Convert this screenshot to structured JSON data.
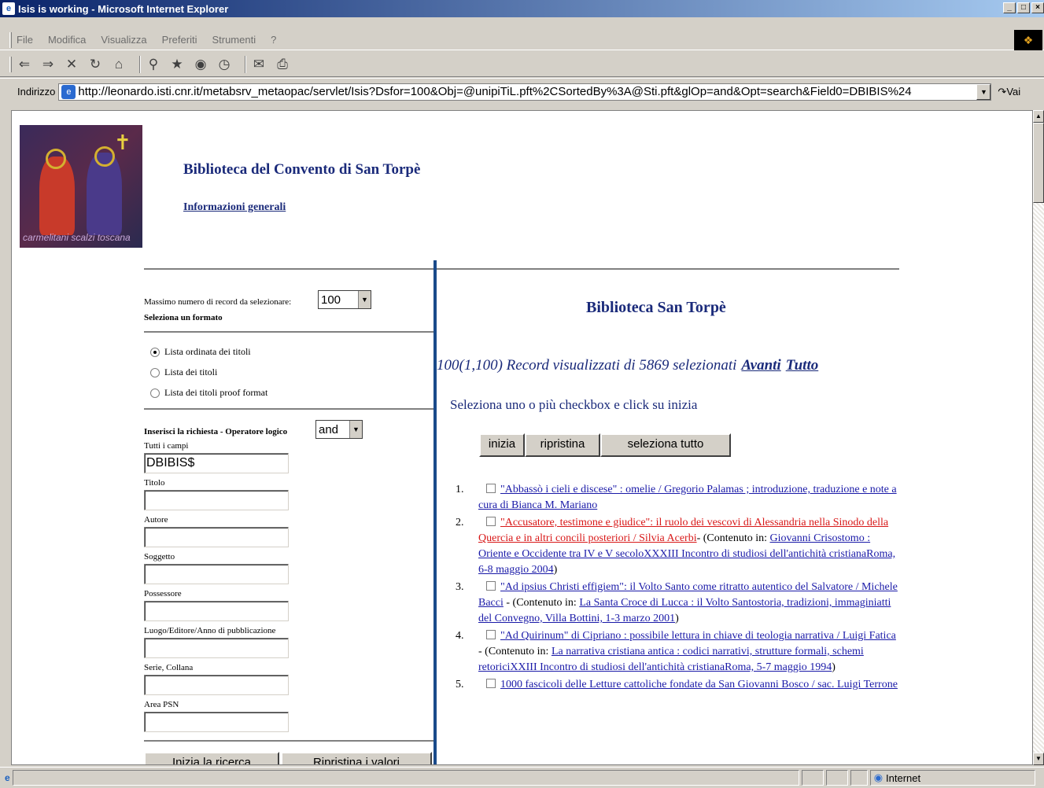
{
  "window": {
    "title": "Isis is working - Microsoft Internet Explorer"
  },
  "menu": [
    "File",
    "Modifica",
    "Visualizza",
    "Preferiti",
    "Strumenti",
    "?"
  ],
  "address": {
    "label": "Indirizzo",
    "url": "http://leonardo.isti.cnr.it/metabsrv_metaopac/servlet/Isis?Dsfor=100&Obj=@unipiTiL.pft%2CSortedBy%3A@Sti.pft&glOp=and&Opt=search&Field0=DBIBIS%24",
    "go": "Vai"
  },
  "header": {
    "title": "Biblioteca del Convento di San Torpè",
    "info_link": "Informazioni generali",
    "logo_caption": "carmelitani scalzi toscana"
  },
  "form": {
    "max_label": "Massimo numero di record da selezionare:",
    "max_value": "100",
    "format_label": "Seleziona un formato",
    "formats": [
      "Lista ordinata dei titoli",
      "Lista dei titoli",
      "Lista dei titoli proof format"
    ],
    "query_label": "Inserisci la richiesta - Operatore logico",
    "operator": "and",
    "fields": [
      {
        "label": "Tutti i campi",
        "value": "DBIBIS$"
      },
      {
        "label": "Titolo",
        "value": ""
      },
      {
        "label": "Autore",
        "value": ""
      },
      {
        "label": "Soggetto",
        "value": ""
      },
      {
        "label": "Possessore",
        "value": ""
      },
      {
        "label": "Luogo/Editore/Anno di pubblicazione",
        "value": ""
      },
      {
        "label": "Serie, Collana",
        "value": ""
      },
      {
        "label": "Area PSN",
        "value": ""
      }
    ],
    "search_button": "Inizia la ricerca",
    "reset_button": "Ripristina i valori"
  },
  "results": {
    "library": "Biblioteca San Torpè",
    "summary": "100(1,100) Record visualizzati di 5869 selezionati",
    "next": "Avanti",
    "all": "Tutto",
    "instruction": "Seleziona uno o più checkbox e click su inizia",
    "buttons": {
      "start": "inizia",
      "reset": "ripristina",
      "select_all": "seleziona tutto"
    },
    "items": [
      {
        "n": "1.",
        "title": "\"Abbassò i cieli e discese\" : omelie / Gregorio Palamas ; introduzione, traduzione e note a cura di Bianca M. Mariano",
        "highlight": false
      },
      {
        "n": "2.",
        "title": "\"Accusatore, testimone e giudice\": il ruolo dei vescovi di Alessandria nella Sinodo della Quercia e in altri concili posteriori / Silvia Acerbi",
        "highlight": true,
        "in_prefix": "- (Contenuto in: ",
        "in": "Giovanni Crisostomo : Oriente e Occidente tra IV e V secoloXXXIII Incontro di studiosi dell'antichità cristianaRoma, 6-8 maggio 2004",
        "in_suffix": ")"
      },
      {
        "n": "3.",
        "title": "\"Ad ipsius Christi effigiem\": il Volto Santo come ritratto autentico del Salvatore / Michele Bacci",
        "highlight": false,
        "in_prefix": " - (Contenuto in: ",
        "in": "La Santa Croce di Lucca : il Volto Santostoria, tradizioni, immaginiatti del Convegno, Villa Bottini, 1-3 marzo 2001",
        "in_suffix": ")"
      },
      {
        "n": "4.",
        "title": "\"Ad Quirinum\" di Cipriano : possibile lettura in chiave di teologia narrativa / Luigi Fatica",
        "highlight": false,
        "in_prefix": " - (Contenuto in: ",
        "in": "La narrativa cristiana antica : codici narrativi, strutture formali, schemi retoriciXXIII Incontro di studiosi dell'antichità cristianaRoma, 5-7 maggio 1994",
        "in_suffix": ")"
      },
      {
        "n": "5.",
        "title": "1000 fascicoli delle Letture cattoliche fondate da San Giovanni Bosco / sac. Luigi Terrone",
        "highlight": false
      }
    ]
  },
  "status": {
    "zone": "Internet"
  }
}
